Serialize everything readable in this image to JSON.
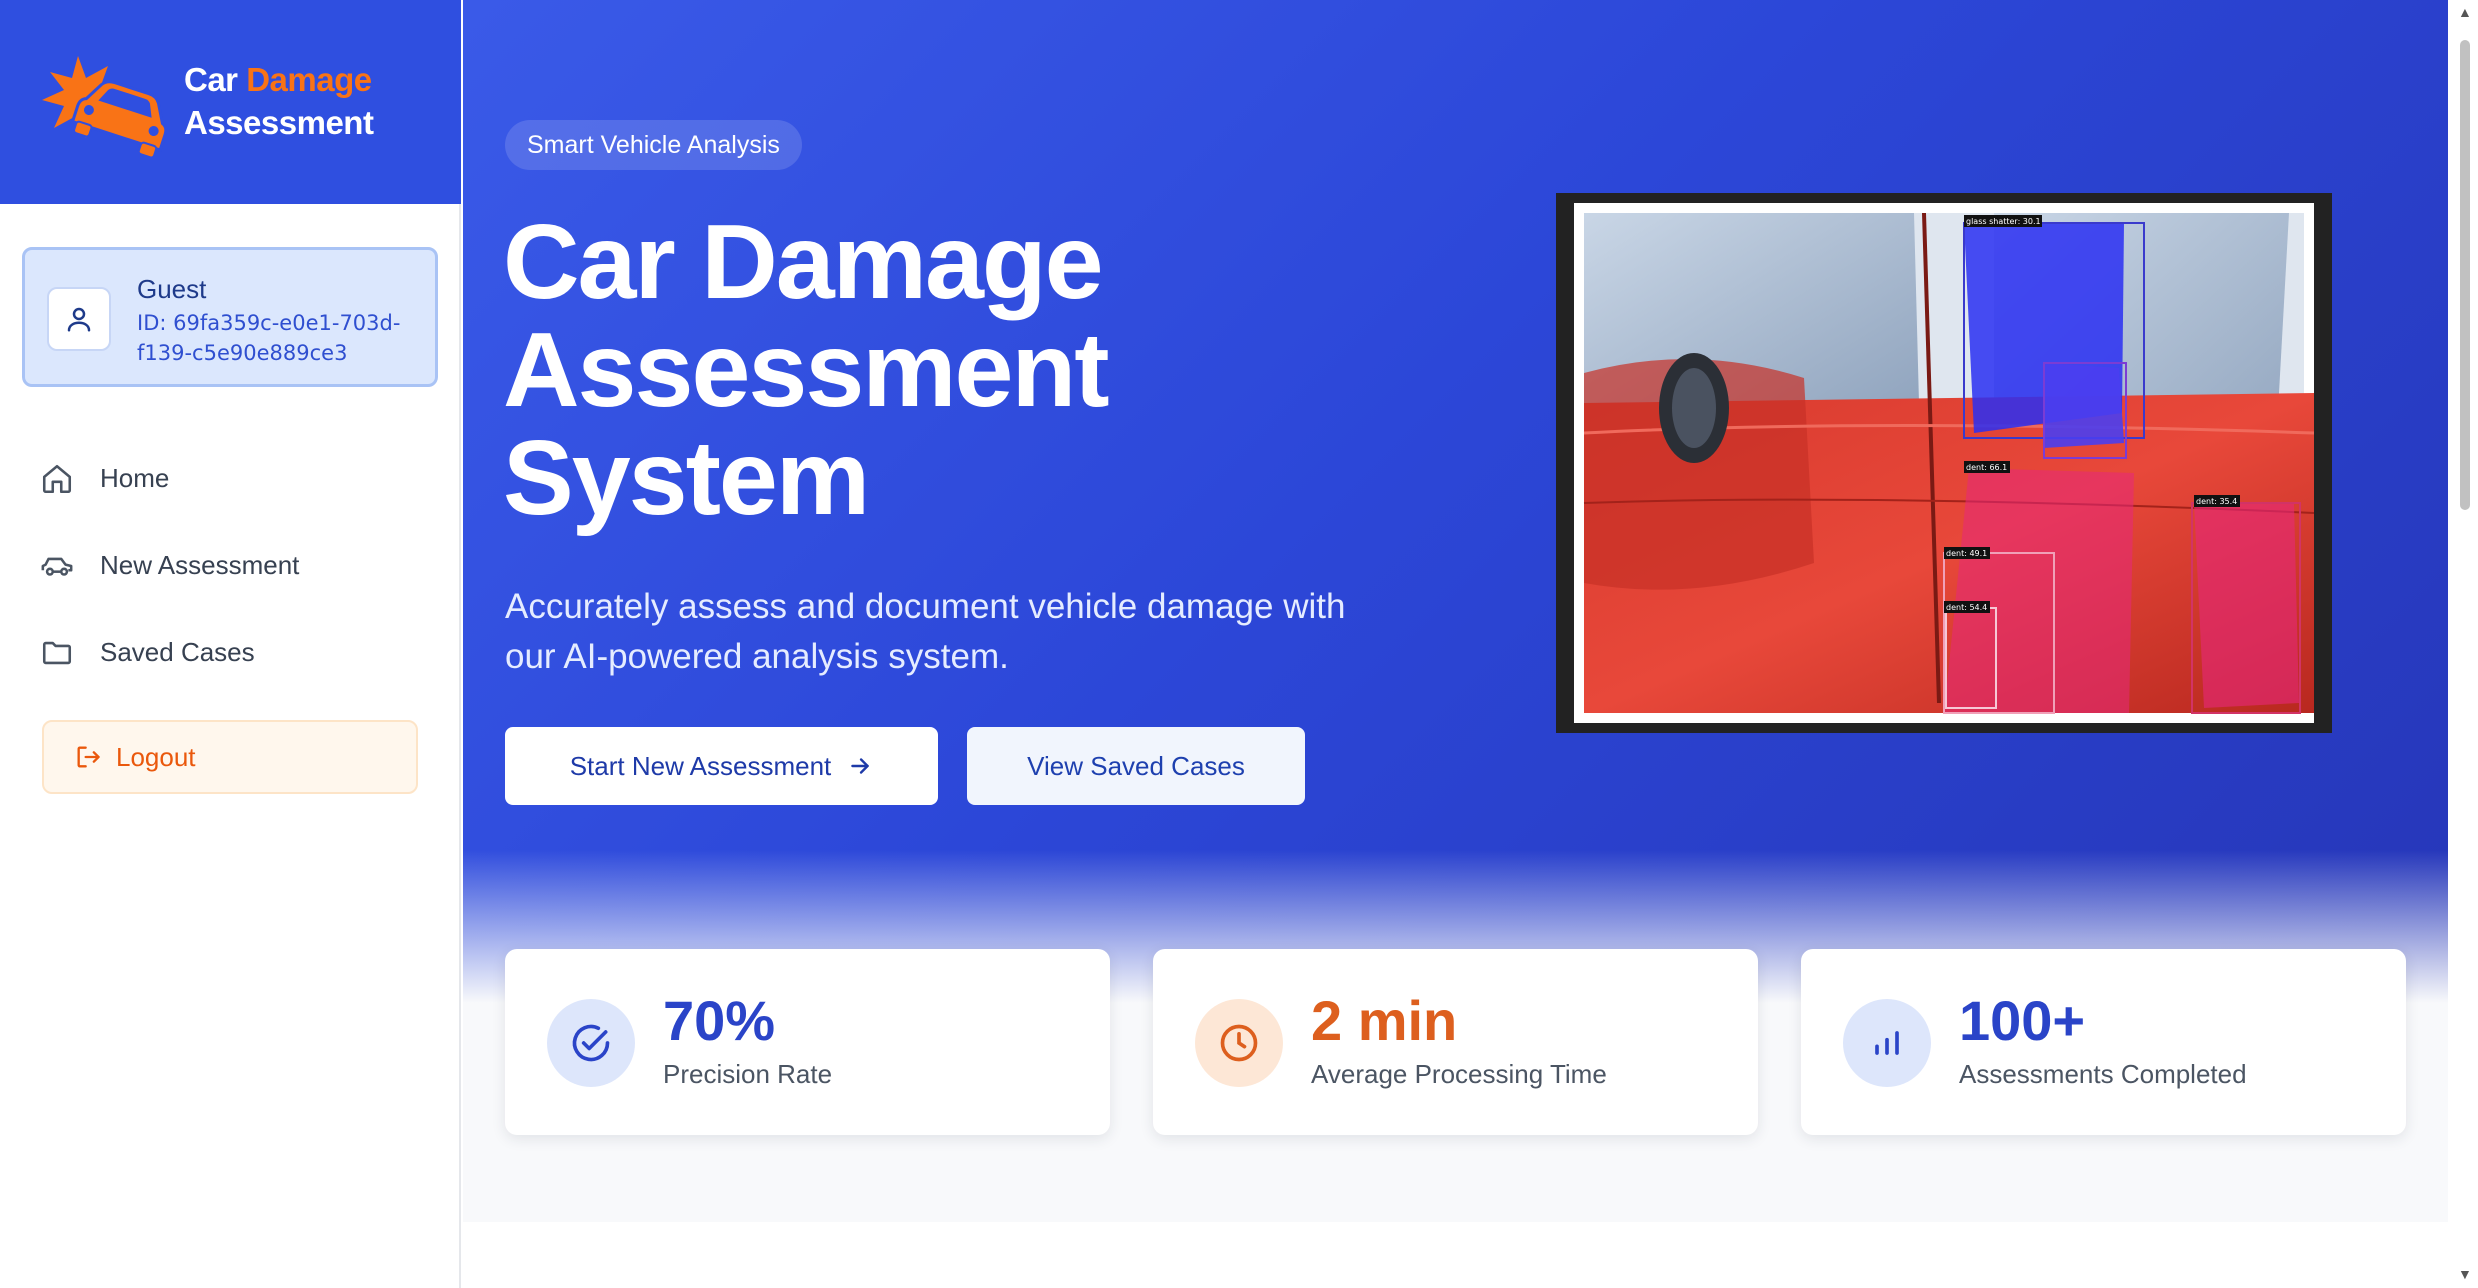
{
  "brand": {
    "name_part1": "Car",
    "name_part2": "Damage",
    "name_part3": "Assessment"
  },
  "user": {
    "name": "Guest",
    "id_text": "ID: 69fa359c-e0e1-703d-f139-c5e90e889ce3"
  },
  "nav": {
    "items": [
      {
        "label": "Home",
        "icon": "home-icon"
      },
      {
        "label": "New Assessment",
        "icon": "car-icon"
      },
      {
        "label": "Saved Cases",
        "icon": "folder-icon"
      }
    ],
    "logout_label": "Logout"
  },
  "hero": {
    "pill": "Smart Vehicle Analysis",
    "title_line1": "Car Damage",
    "title_line2": "Assessment",
    "title_line3": "System",
    "subtitle": "Accurately assess and document vehicle damage with our AI-powered analysis system.",
    "primary_button": "Start New Assessment",
    "secondary_button": "View Saved Cases",
    "image_labels": [
      "glass shatter: 30.1",
      "dent: 66.1",
      "dent: 49.1",
      "dent: 54.4",
      "dent: 35.4"
    ]
  },
  "stats": [
    {
      "value": "70%",
      "label": "Precision Rate",
      "icon": "check-circle-icon",
      "color": "#2a44c8",
      "bg": "#dde6fb"
    },
    {
      "value": "2 min",
      "label": "Average Processing Time",
      "icon": "clock-icon",
      "color": "#dd5f1e",
      "bg": "#fde7d6"
    },
    {
      "value": "100+",
      "label": "Assessments Completed",
      "icon": "bar-chart-icon",
      "color": "#2a44c8",
      "bg": "#dde6fb"
    }
  ],
  "colors": {
    "primary": "#2f4fe0",
    "accent": "#f97316"
  }
}
